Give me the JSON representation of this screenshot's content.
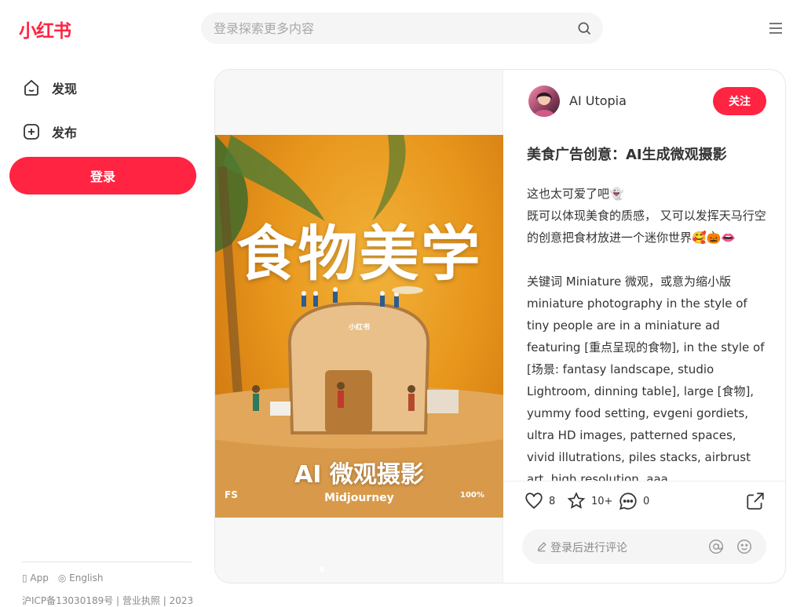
{
  "header": {
    "logo": "小红书",
    "search_placeholder": "登录探索更多内容"
  },
  "sidebar": {
    "items": [
      {
        "label": "发现",
        "icon": "home-icon"
      },
      {
        "label": "发布",
        "icon": "plus-square-icon"
      }
    ],
    "login_label": "登录",
    "links": {
      "app": "App",
      "lang": "English"
    },
    "footer": "沪ICP备13030189号 | 营业执照 | 2023"
  },
  "note": {
    "author": "AI Utopia",
    "follow_label": "关注",
    "title": "美食广告创意：AI生成微观摄影",
    "content": [
      "这也太可爱了吧👻",
      "既可以体现美食的质感， 又可以发挥天马行空的创意把食材放进一个迷你世界🥰🎃👄",
      "",
      "关键词 Miniature 微观，或意为缩小版 miniature photography in the style of tiny people are in a miniature ad featuring [重点呈现的食物], in the style of [场景: fantasy landscape, studio Lightroom, dinning table], large [食物], yummy food setting, evgeni gordiets, ultra HD images, patterned spaces, vivid illutrations, piles stacks, airbrust art, high resolution, aaa"
    ],
    "poster": {
      "headline": "食物美学",
      "subtitle": "AI 微观摄影",
      "tag": "Midjourney",
      "badge": "小红书",
      "corner_left": "FS",
      "corner_right": "100%"
    },
    "stats": {
      "likes": "8",
      "collects": "10+",
      "comments": "0"
    },
    "comment_placeholder": "登录后进行评论"
  },
  "colors": {
    "brand": "#ff2442"
  }
}
